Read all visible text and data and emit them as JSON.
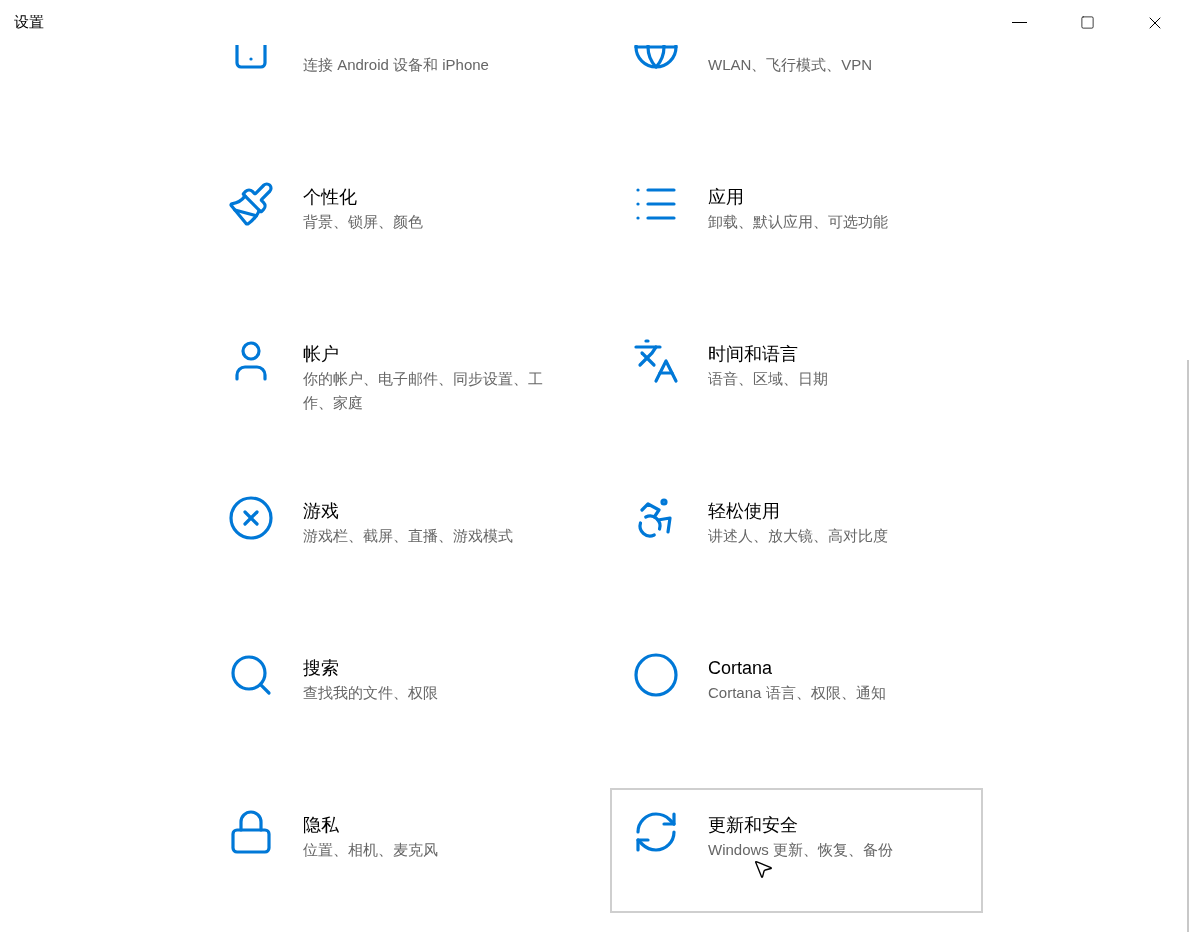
{
  "window": {
    "title": "设置",
    "controls": [
      {
        "kind": "minimize"
      },
      {
        "kind": "maximize"
      },
      {
        "kind": "close"
      }
    ]
  },
  "categories": [
    {
      "description": "连接 Android 设备和 iPhone",
      "hovered": false
    },
    {
      "description": "WLAN、飞行模式、VPN",
      "hovered": false
    },
    {
      "title": "个性化",
      "description": "背景、锁屏、颜色",
      "hovered": false
    },
    {
      "title": "应用",
      "description": "卸载、默认应用、可选功能",
      "hovered": false
    },
    {
      "title": "帐户",
      "description": "你的帐户、电子邮件、同步设置、工作、家庭",
      "hovered": false
    },
    {
      "title": "时间和语言",
      "description": "语音、区域、日期",
      "hovered": false
    },
    {
      "title": "游戏",
      "description": "游戏栏、截屏、直播、游戏模式",
      "hovered": false
    },
    {
      "title": "轻松使用",
      "description": "讲述人、放大镜、高对比度",
      "hovered": false
    },
    {
      "title": "搜索",
      "description": "查找我的文件、权限",
      "hovered": false
    },
    {
      "title": "Cortana",
      "description": "Cortana 语言、权限、通知",
      "hovered": false
    },
    {
      "title": "隐私",
      "description": "位置、相机、麦克风",
      "hovered": false
    },
    {
      "title": "更新和安全",
      "description": "Windows 更新、恢复、备份",
      "hovered": true
    }
  ]
}
